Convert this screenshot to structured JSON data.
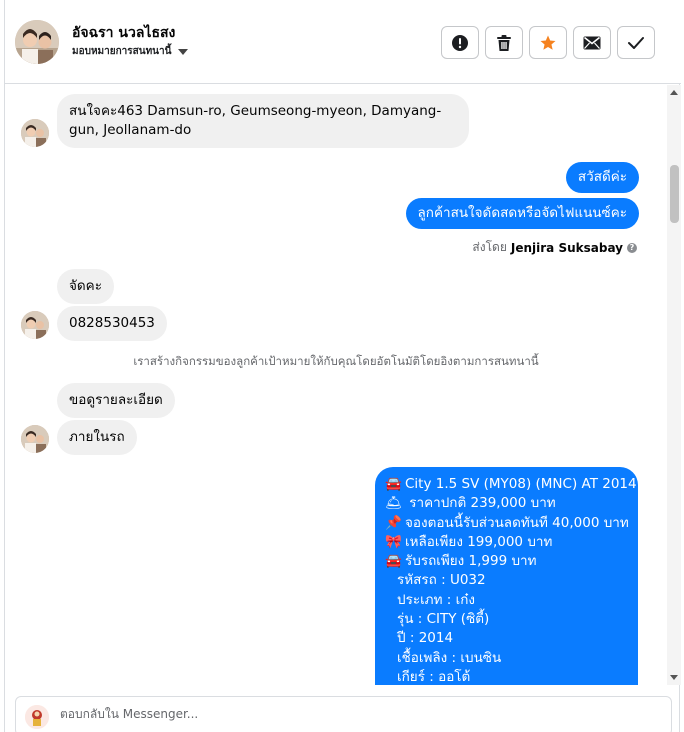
{
  "header": {
    "contact_name": "อัจฉรา นวลไธสง",
    "assign_label": "มอบหมายการสนทนานี้",
    "actions": [
      {
        "name": "report-button",
        "icon": "alert-icon"
      },
      {
        "name": "delete-button",
        "icon": "trash-icon"
      },
      {
        "name": "star-button",
        "icon": "star-icon",
        "color": "#f5821f"
      },
      {
        "name": "mark-unread-button",
        "icon": "envelope-icon"
      },
      {
        "name": "mark-done-button",
        "icon": "check-icon"
      }
    ]
  },
  "messages": {
    "in_1": "สนใจคะ463 Damsun-ro, Geumseong-myeon, Damyang-gun, Jeollanam-do",
    "out_1": "สวัสดีค่ะ",
    "out_2": "ลูกค้าสนใจดัดสดหรือจัดไฟแนนซ์คะ",
    "sent_by_prefix": "ส่งโดย",
    "sent_by_name": "Jenjira Suksabay",
    "in_2": "จัดคะ",
    "in_3": "0828530453",
    "system_note": "เราสร้างกิจกรรมของลูกค้าเป้าหมายให้กับคุณโดยอัตโนมัติโดยอิงตามการสนทนานี้",
    "in_4": "ขอดูรายละเอียด",
    "in_5": "ภายในรถ"
  },
  "card": {
    "lines": [
      {
        "emoji": "🚘",
        "text": "City 1.5 SV (MY08) (MNC) AT 2014"
      },
      {
        "emoji": "🛎",
        "text": " ราคาปกติ  239,000 บาท"
      },
      {
        "emoji": "📌",
        "text": "จองตอนนี้รับส่วนลดทันที 40,000 บาท"
      },
      {
        "emoji": "🎀",
        "text": "เหลือเพียง 199,000 บาท"
      },
      {
        "emoji": "🚘",
        "text": "รับรถเพียง 1,999 บาท"
      },
      {
        "emoji": "",
        "text": "รหัสรถ : U032"
      },
      {
        "emoji": "",
        "text": "ประเภท : เก๋ง"
      },
      {
        "emoji": "",
        "text": "รุ่น : CITY (ซิตี้)"
      },
      {
        "emoji": "",
        "text": "ปี : 2014"
      },
      {
        "emoji": "",
        "text": "เชื้อเพลิง : เบนซิน"
      },
      {
        "emoji": "",
        "text": "เกียร์ : ออโต้"
      }
    ]
  },
  "composer": {
    "placeholder": "ตอบกลับใน Messenger..."
  },
  "colors": {
    "outgoing": "#0a7cff",
    "incoming": "#f0f0f0",
    "star": "#f5821f"
  }
}
